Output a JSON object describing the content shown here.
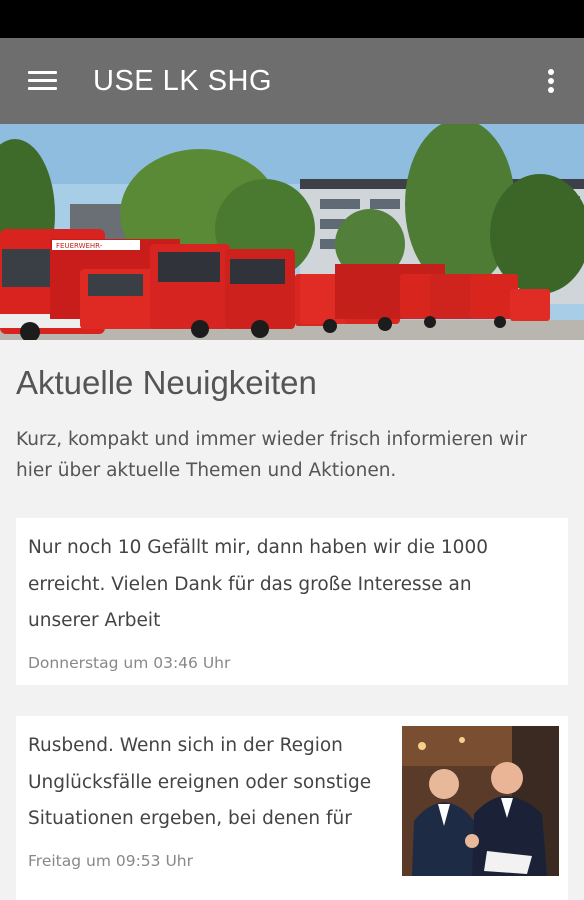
{
  "app_bar": {
    "title": "USE LK SHG",
    "menu_icon": "hamburger-menu-icon",
    "overflow_icon": "more-vert-icon",
    "background": "#6e6e6e"
  },
  "header_image": {
    "truck_text": "FEUERWEHR-"
  },
  "news_section": {
    "title": "Aktuelle Neuigkeiten",
    "description": "Kurz, kompakt und immer wieder frisch informieren wir hier über aktuelle Themen und Aktionen."
  },
  "posts": [
    {
      "text": "Nur noch 10 Gefällt mir, dann haben wir die 1000 erreicht. Vielen Dank für das große Interesse an unserer Arbeit",
      "date": "Donnerstag um 03:46 Uhr"
    },
    {
      "text": "Rusbend. Wenn sich in der Region Unglücksfälle ereignen oder sonstige Situationen ergeben, bei denen für",
      "date": "Freitag um 09:53 Uhr"
    }
  ]
}
